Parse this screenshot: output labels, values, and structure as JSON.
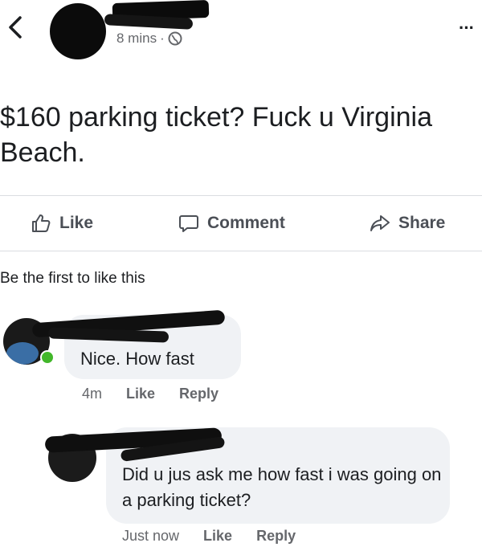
{
  "header": {
    "back_icon": "chevron-left-icon",
    "time": "8 mins",
    "separator": "·",
    "privacy_icon": "globe-icon",
    "more_label": "···"
  },
  "post": {
    "text": "$160 parking ticket? Fuck u Virginia Beach."
  },
  "actions": {
    "like": "Like",
    "comment": "Comment",
    "share": "Share"
  },
  "likes_summary": "Be the first to like this",
  "comments": [
    {
      "text": "Nice. How fast",
      "time": "4m",
      "like": "Like",
      "reply": "Reply"
    },
    {
      "text": "Did u jus ask me how fast i was going on a parking ticket?",
      "time": "Just now",
      "like": "Like",
      "reply": "Reply"
    }
  ],
  "colors": {
    "text": "#1c1e21",
    "secondary": "#65676b",
    "bubble": "#f0f2f5",
    "online": "#42b72a",
    "divider": "#dadde1"
  }
}
